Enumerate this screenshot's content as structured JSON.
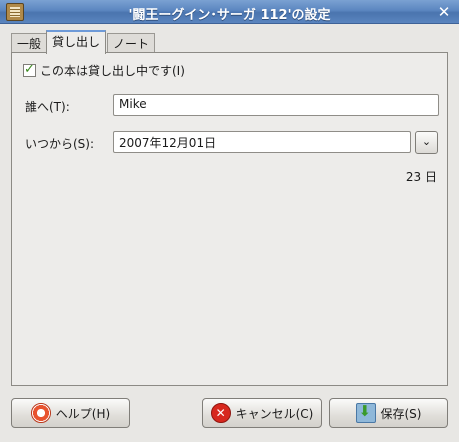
{
  "window": {
    "title": "'闘王ーグイン･サーガ 112'の設定",
    "close_symbol": "✕"
  },
  "tabs": [
    {
      "label": "一般"
    },
    {
      "label": "貸し出し"
    },
    {
      "label": "ノート"
    }
  ],
  "loan": {
    "checkbox_label": "この本は貸し出し中です(I)",
    "checked": true,
    "to_label": "誰へ(T):",
    "to_value": "Mike",
    "since_label": "いつから(S):",
    "since_value": "2007年12月01日",
    "dropdown_symbol": "⌄",
    "days_text": "23 日"
  },
  "buttons": {
    "help": "ヘルプ(H)",
    "cancel": "キャンセル(C)",
    "save": "保存(S)"
  }
}
